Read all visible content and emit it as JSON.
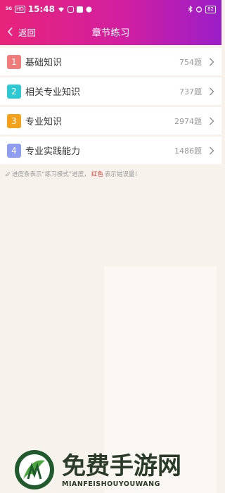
{
  "status_bar": {
    "signal": "5G",
    "chip": "HD",
    "time": "15:48",
    "battery": "82"
  },
  "nav": {
    "back_label": "返回",
    "title": "章节练习"
  },
  "chapters": [
    {
      "index": "1",
      "name": "基础知识",
      "count": "754题",
      "color": "#ef7b7b"
    },
    {
      "index": "2",
      "name": "相关专业知识",
      "count": "737题",
      "color": "#2cc9d3"
    },
    {
      "index": "3",
      "name": "专业知识",
      "count": "2974题",
      "color": "#f5a21b"
    },
    {
      "index": "4",
      "name": "专业实践能力",
      "count": "1486题",
      "color": "#8e9df0"
    }
  ],
  "note": {
    "before": "进度条表示“练习模式”进度，",
    "red": "红色",
    "after": "表示错误量！"
  },
  "watermark": {
    "title": "免费手游网",
    "subtitle": "MIANFEISHOUYOUWANG"
  },
  "colors": {
    "header_start": "#e8247a",
    "header_end": "#9b1ec8"
  }
}
